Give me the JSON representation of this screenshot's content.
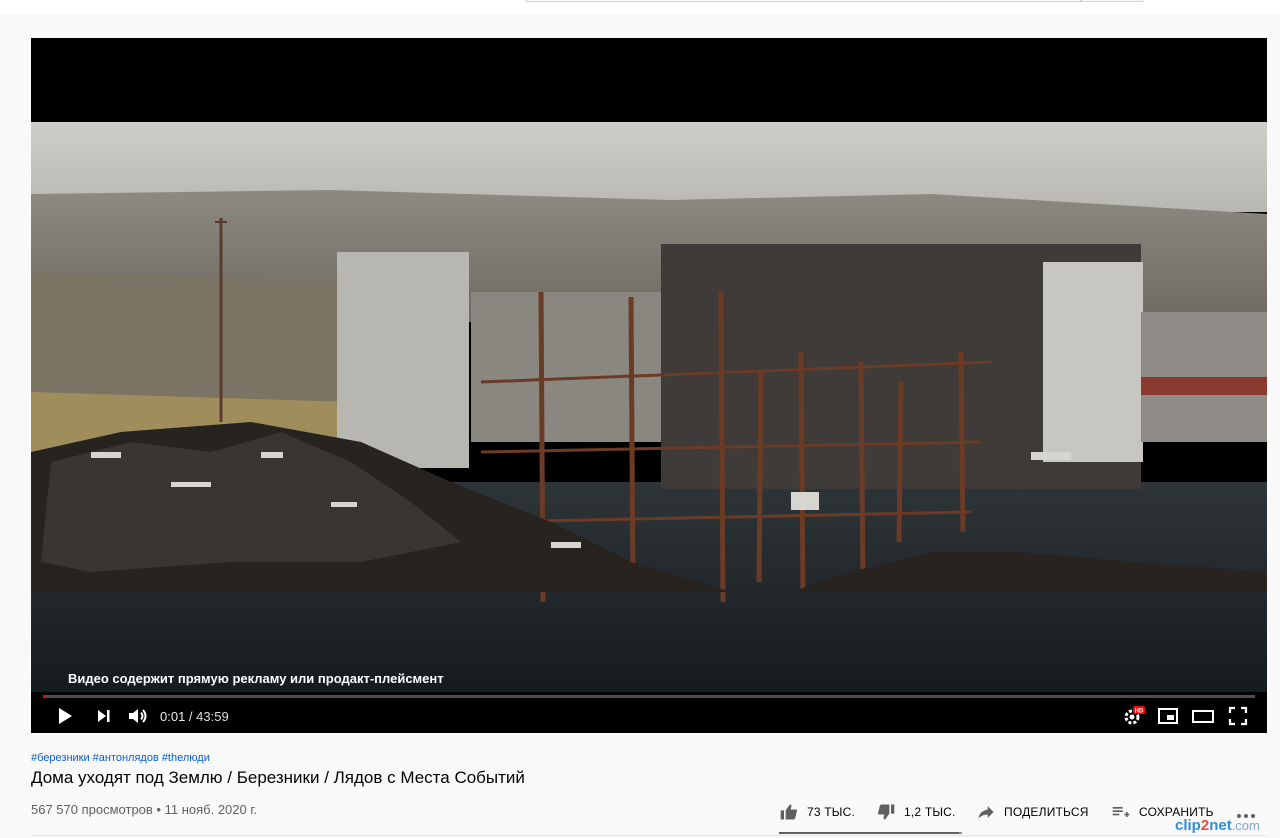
{
  "player": {
    "ad_notice": "Видео содержит прямую рекламу или продакт-плейсмент",
    "current_time": "0:01",
    "total_time": "43:59",
    "time_separator": " / ",
    "progress_fraction": 0.0004
  },
  "controls": {
    "play_icon": "play-icon",
    "next_icon": "next-icon",
    "volume_icon": "volume-icon",
    "settings_icon": "settings-gear-hd-icon",
    "hd_badge": "HD",
    "miniplayer_icon": "miniplayer-icon",
    "theater_icon": "theater-mode-icon",
    "fullscreen_icon": "fullscreen-icon"
  },
  "video": {
    "hashtags": [
      "#березники",
      "#антонлядов",
      "#thелюди"
    ],
    "title": "Дома уходят под Землю / Березники / Лядов с Места Событий",
    "views": "567 570 просмотров",
    "separator": " • ",
    "date": "11 нояб. 2020 г."
  },
  "actions": {
    "like_count": "73 ТЫС.",
    "dislike_count": "1,2 ТЫС.",
    "share_label": "ПОДЕЛИТЬСЯ",
    "save_label": "СОХРАНИТЬ",
    "more_icon": "more-horiz-icon",
    "like_ratio": 0.984
  },
  "watermark": {
    "part1": "clip",
    "part2": "2",
    "part3": "net",
    "part4": ".com"
  },
  "colors": {
    "accent_red": "#ff0000",
    "link_blue": "#065fd4",
    "secondary_text": "#606060"
  }
}
